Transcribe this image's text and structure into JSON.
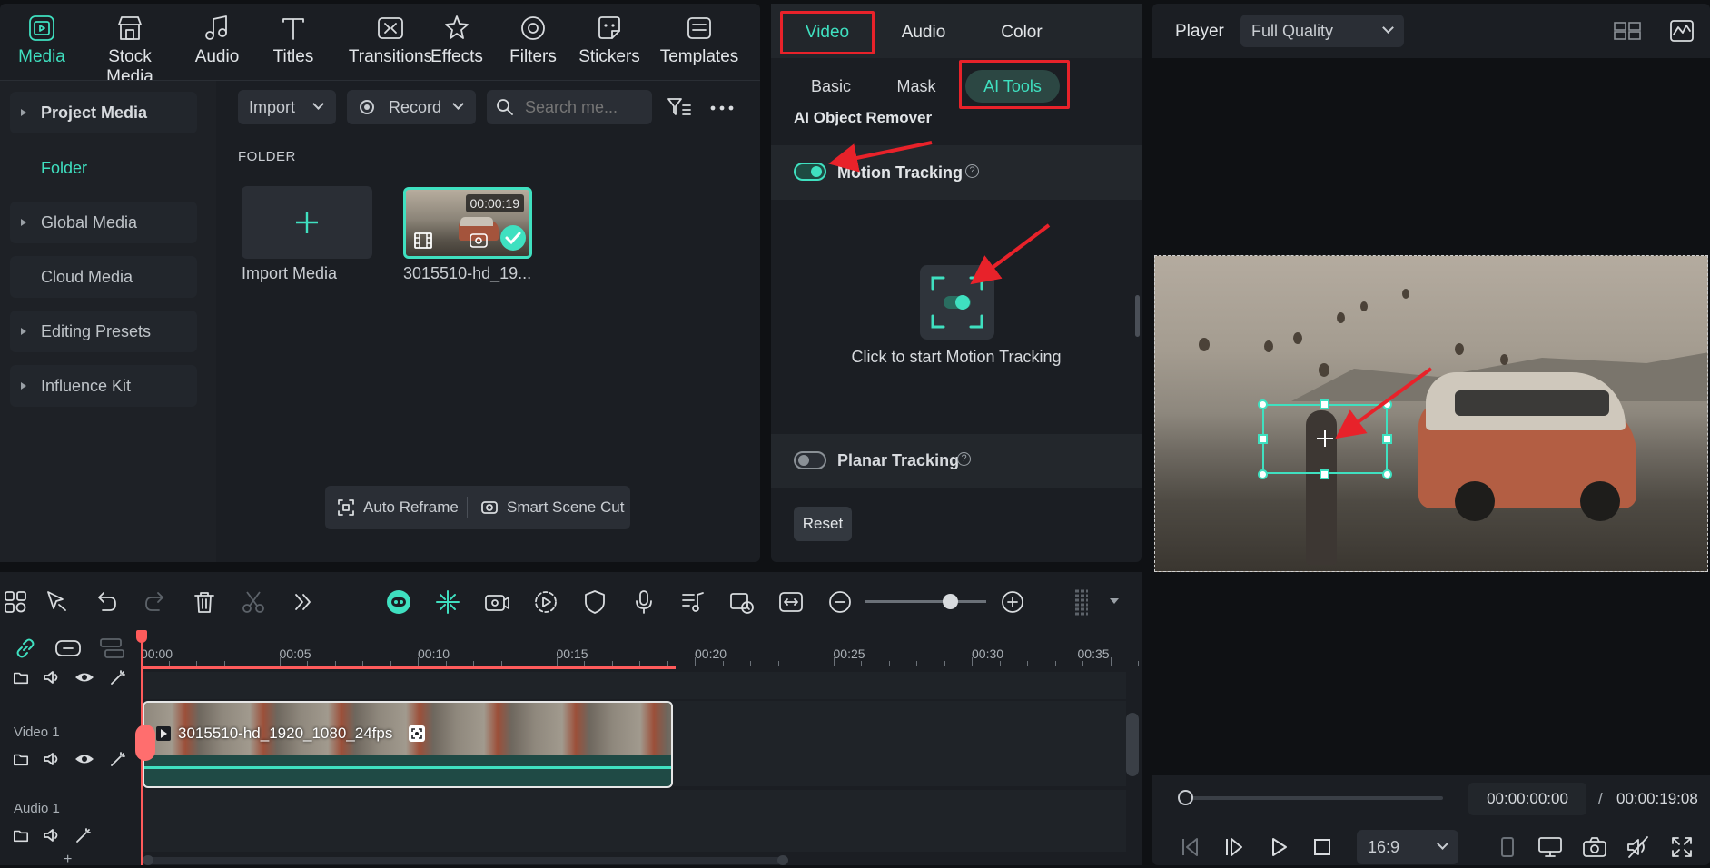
{
  "toolbar": {
    "items": [
      {
        "label": "Media",
        "icon": "media-icon",
        "active": true
      },
      {
        "label": "Stock Media",
        "icon": "stock-media-icon"
      },
      {
        "label": "Audio",
        "icon": "audio-note-icon"
      },
      {
        "label": "Titles",
        "icon": "titles-t-icon"
      },
      {
        "label": "Transitions",
        "icon": "transitions-icon"
      },
      {
        "label": "Effects",
        "icon": "effects-icon"
      },
      {
        "label": "Filters",
        "icon": "filters-icon"
      },
      {
        "label": "Stickers",
        "icon": "stickers-icon"
      },
      {
        "label": "Templates",
        "icon": "templates-icon"
      }
    ]
  },
  "sidebar": {
    "items": [
      {
        "label": "Project Media",
        "expandable": true
      },
      {
        "label": "Folder",
        "active": true
      },
      {
        "label": "Global Media",
        "expandable": true
      },
      {
        "label": "Cloud Media"
      },
      {
        "label": "Editing Presets",
        "expandable": true
      },
      {
        "label": "Influence Kit",
        "expandable": true
      }
    ]
  },
  "media": {
    "import_label": "Import",
    "record_label": "Record",
    "search_placeholder": "Search me...",
    "folder_heading": "FOLDER",
    "import_media_label": "Import Media",
    "clip_name": "3015510-hd_19...",
    "clip_duration": "00:00:19",
    "auto_reframe": "Auto Reframe",
    "smart_scene_cut": "Smart Scene Cut"
  },
  "properties": {
    "tabs": [
      "Video",
      "Audio",
      "Color"
    ],
    "subtabs": [
      "Basic",
      "Mask",
      "AI Tools"
    ],
    "section_title": "AI Object Remover",
    "motion_tracking_label": "Motion Tracking",
    "motion_tracking_on": true,
    "start_tracking_label": "Click to start Motion Tracking",
    "planar_tracking_label": "Planar Tracking",
    "planar_tracking_on": false,
    "reset_label": "Reset"
  },
  "player": {
    "title": "Player",
    "quality": "Full Quality",
    "current_time": "00:00:00:00",
    "separator": "/",
    "total_time": "00:00:19:08",
    "aspect": "16:9",
    "progress": 0
  },
  "timeline": {
    "ticks": [
      "00:00",
      "00:05",
      "00:10",
      "00:15",
      "00:20",
      "00:25",
      "00:30",
      "00:35"
    ],
    "tracks": [
      {
        "label": "Video 1",
        "clip": "3015510-hd_1920_1080_24fps"
      },
      {
        "label": "Audio 1"
      }
    ],
    "zoom_level": 0.7
  },
  "colors": {
    "accent": "#3fe0c0",
    "annotation_red": "#e8222a",
    "playhead": "#ff5b5b"
  }
}
